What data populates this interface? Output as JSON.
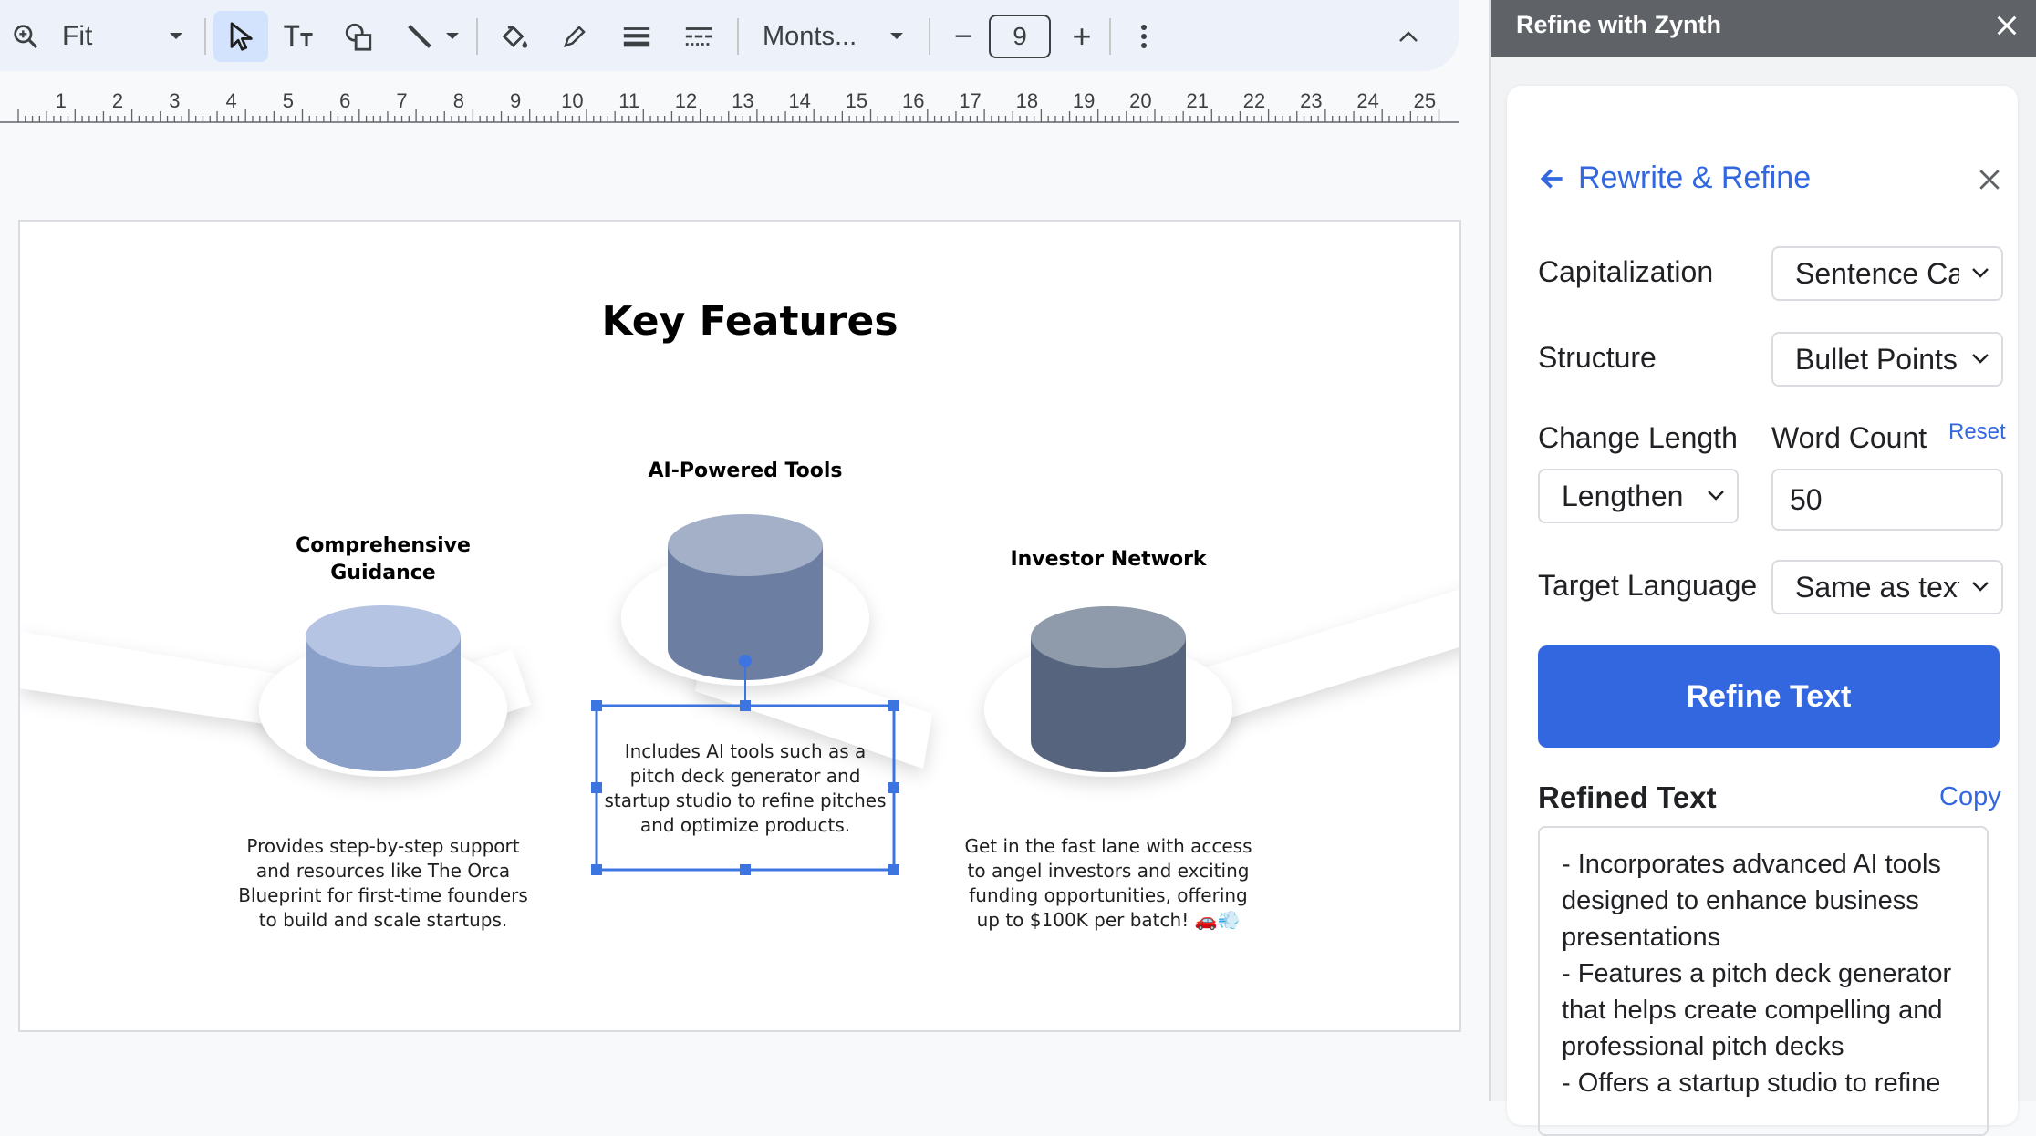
{
  "toolbar": {
    "zoom_label": "Fit",
    "font_label": "Monts...",
    "font_size": "9",
    "minus": "−",
    "plus": "+"
  },
  "ruler": {
    "marks": [
      "1",
      "2",
      "3",
      "4",
      "5",
      "6",
      "7",
      "8",
      "9",
      "10",
      "11",
      "12",
      "13",
      "14",
      "15",
      "16",
      "17",
      "18",
      "19",
      "20",
      "21",
      "22",
      "23",
      "24",
      "25"
    ]
  },
  "slide": {
    "title": "Key Features",
    "features": [
      {
        "title": "Comprehensive Guidance",
        "desc": "Provides step-by-step support and resources like The Orca Blueprint for first-time founders to build and scale startups.",
        "color": "#8aa0c9"
      },
      {
        "title": "AI-Powered Tools",
        "desc": "Includes AI tools such as a pitch deck generator and startup studio to refine pitches and optimize products.",
        "color": "#6c7fa3"
      },
      {
        "title": "Investor Network",
        "desc": "Get in the fast lane with access to angel investors and exciting funding opportunities, offering up to $100K per batch! 🚗💨",
        "color": "#56647d"
      }
    ]
  },
  "panel": {
    "header_title": "Refine with Zynth",
    "section_title": "Rewrite & Refine",
    "capitalization_label": "Capitalization",
    "capitalization_value": "Sentence Case",
    "structure_label": "Structure",
    "structure_value": "Bullet Points",
    "change_length_label": "Change Length",
    "change_length_value": "Lengthen",
    "word_count_label": "Word Count",
    "word_count_value": "50",
    "reset_label": "Reset",
    "target_language_label": "Target Language",
    "target_language_value": "Same as text",
    "refine_button": "Refine Text",
    "refined_title": "Refined Text",
    "copy_label": "Copy",
    "refined_text": "- Incorporates advanced AI tools designed to enhance business presentations\n- Features a pitch deck generator that helps create compelling and professional pitch decks\n- Offers a startup studio to refine",
    "accent": "#3367e0"
  }
}
